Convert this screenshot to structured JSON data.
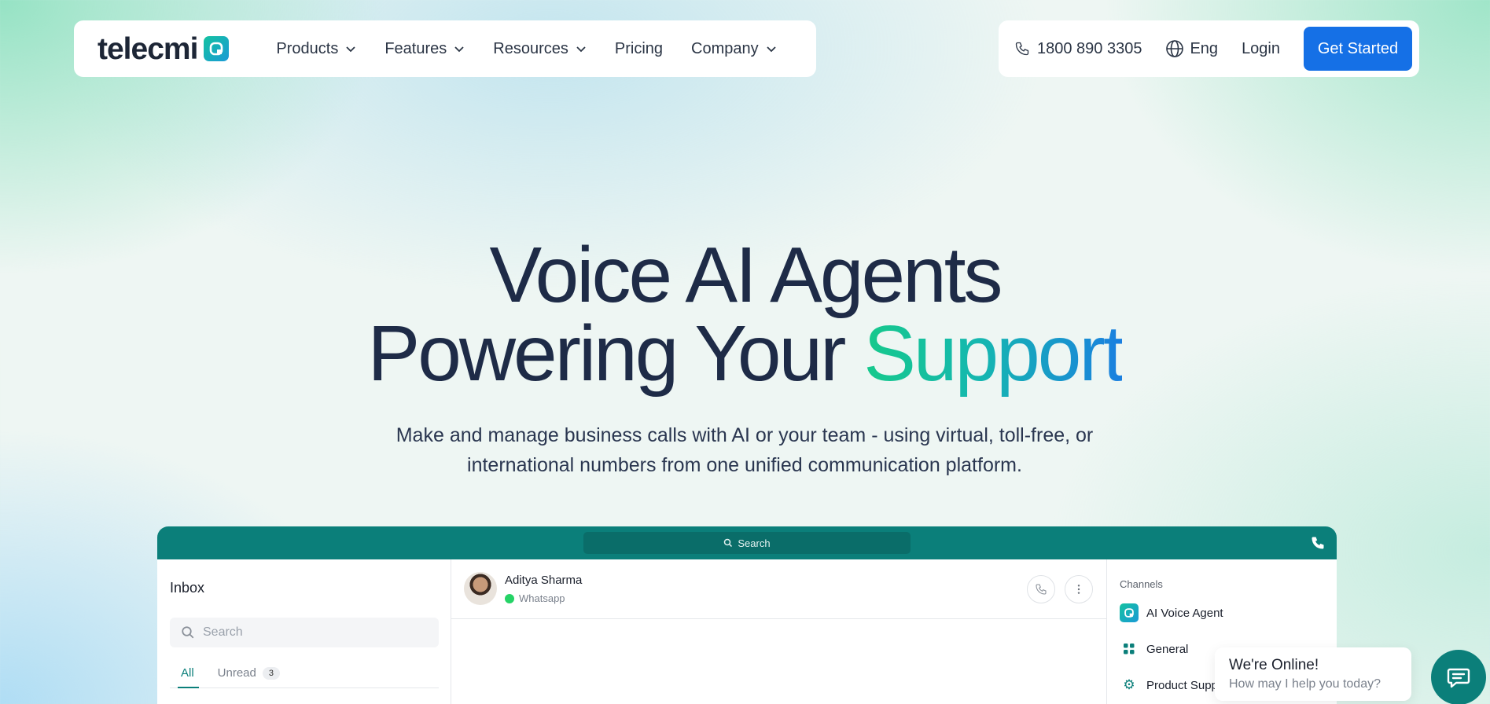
{
  "brand": {
    "name": "telecmi"
  },
  "nav": {
    "menu": [
      {
        "label": "Products",
        "dropdown": true
      },
      {
        "label": "Features",
        "dropdown": true
      },
      {
        "label": "Resources",
        "dropdown": true
      },
      {
        "label": "Pricing",
        "dropdown": false
      },
      {
        "label": "Company",
        "dropdown": true
      }
    ],
    "phone": "1800 890 3305",
    "language": "Eng",
    "login": "Login",
    "cta": "Get Started"
  },
  "hero": {
    "line1": "Voice AI Agents",
    "line2_prefix": "Powering Your ",
    "line2_highlight": "Support",
    "subtitle": "Make and manage business calls with AI or your team - using virtual, toll-free, or international numbers from one unified communication platform."
  },
  "app": {
    "search_label": "Search",
    "inbox": {
      "title": "Inbox",
      "search_placeholder": "Search",
      "tabs": [
        {
          "label": "All",
          "active": true
        },
        {
          "label": "Unread",
          "count": "3"
        }
      ]
    },
    "chat": {
      "contact_name": "Aditya Sharma",
      "channel": "Whatsapp"
    },
    "channels": {
      "title": "Channels",
      "items": [
        "AI Voice Agent",
        "General",
        "Product Supp"
      ]
    }
  },
  "widget": {
    "title": "We're Online!",
    "subtitle": "How may I help you today?"
  },
  "colors": {
    "primary_blue": "#1570e6",
    "teal": "#0b7f7a",
    "heading": "#1e2b47",
    "gradient_start": "#16c98b",
    "gradient_end": "#1a7fe0"
  }
}
